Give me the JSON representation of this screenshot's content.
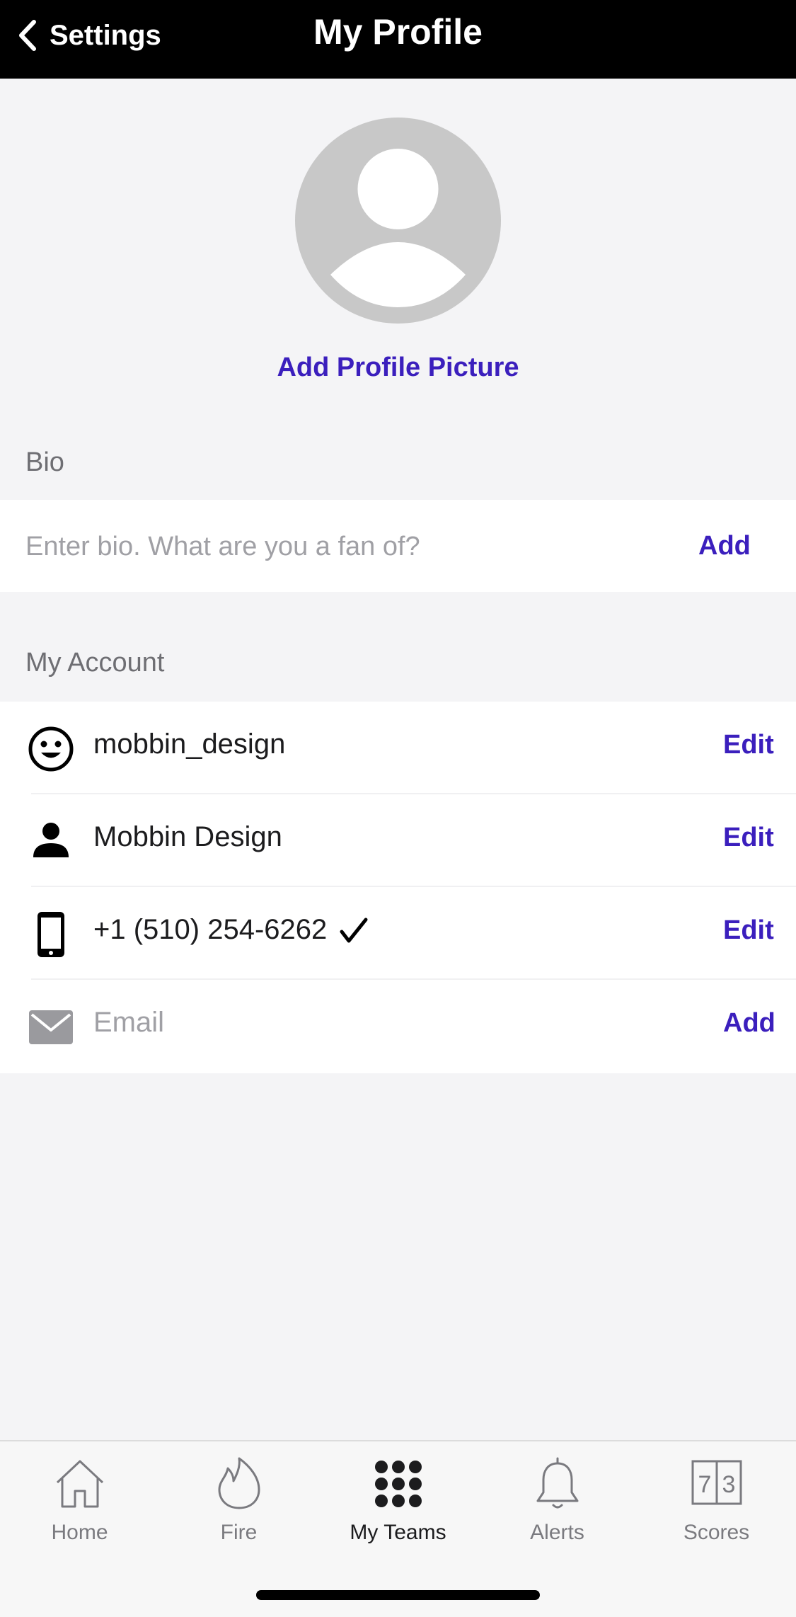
{
  "header": {
    "back_label": "Settings",
    "title": "My Profile"
  },
  "profile": {
    "add_picture_label": "Add Profile Picture"
  },
  "bio": {
    "section_label": "Bio",
    "placeholder": "Enter bio. What are you a fan of?",
    "value": "",
    "action_label": "Add"
  },
  "account": {
    "section_label": "My Account",
    "items": [
      {
        "icon": "smiley-face-icon",
        "text": "mobbin_design",
        "action": "Edit"
      },
      {
        "icon": "person-icon",
        "text": "Mobbin Design",
        "action": "Edit"
      },
      {
        "icon": "phone-icon",
        "text": "+1 (510) 254-6262",
        "verified": true,
        "action": "Edit"
      },
      {
        "icon": "mail-icon",
        "text": "Email",
        "placeholder": true,
        "action": "Add"
      }
    ]
  },
  "tabbar": {
    "tabs": [
      {
        "label": "Home",
        "icon": "home-icon"
      },
      {
        "label": "Fire",
        "icon": "fire-icon"
      },
      {
        "label": "My Teams",
        "icon": "grid-dots-icon",
        "active": true
      },
      {
        "label": "Alerts",
        "icon": "bell-icon"
      },
      {
        "label": "Scores",
        "icon": "scoreboard-icon",
        "digits": [
          "7",
          "3"
        ]
      }
    ]
  },
  "colors": {
    "accent": "#3b1fbd",
    "header_bg": "#000000",
    "page_bg": "#f4f4f6",
    "avatar_bg": "#c8c8c8"
  }
}
